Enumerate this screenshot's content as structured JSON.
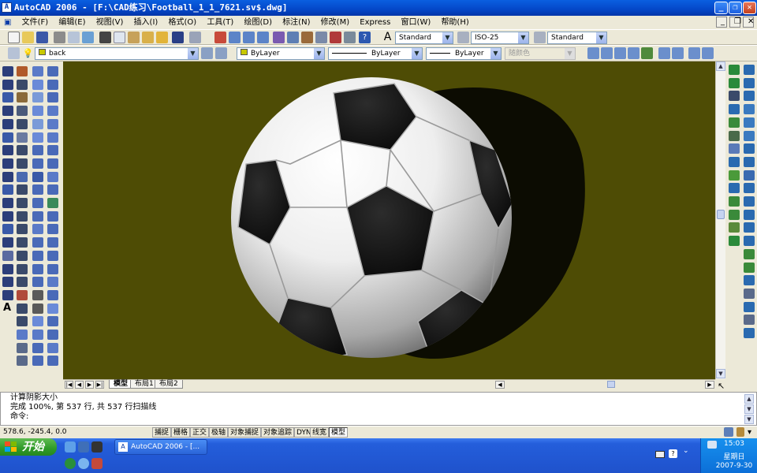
{
  "window": {
    "title": "AutoCAD 2006 - [F:\\CAD练习\\Football_1_1_7621.sv$.dwg]",
    "minimize": "_",
    "restore": "❐",
    "close": "✕"
  },
  "menu": {
    "items": [
      "文件(F)",
      "编辑(E)",
      "视图(V)",
      "插入(I)",
      "格式(O)",
      "工具(T)",
      "绘图(D)",
      "标注(N)",
      "修改(M)",
      "Express",
      "窗口(W)",
      "帮助(H)"
    ]
  },
  "toolbar_styles": {
    "text_style": "Standard",
    "dim_style": "ISO-25",
    "table_style": "Standard"
  },
  "toolbar_layers": {
    "layer": "back",
    "color": "ByLayer",
    "linetype": "ByLayer",
    "lineweight": "ByLayer",
    "plotstyle": "随颜色"
  },
  "layout_tabs": [
    "模型",
    "布局1",
    "布局2"
  ],
  "command": {
    "lines": [
      "计算阴影大小",
      "完成 100%, 第 537 行, 共 537 行扫描线"
    ],
    "prompt": "命令:"
  },
  "status": {
    "coords": "578.6,  -245.4, 0.0",
    "toggles": [
      "捕捉",
      "栅格",
      "正交",
      "极轴",
      "对象捕捉",
      "对象追踪",
      "DYN",
      "线宽",
      "模型"
    ]
  },
  "taskbar": {
    "start": "开始",
    "task": "AutoCAD 2006 - [...",
    "time": "15:03",
    "weekday": "星期日",
    "date": "2007-9-30"
  },
  "colors": {
    "viewport_bg": "#4e4c05",
    "titlebar": "#0447c8",
    "taskbar": "#245edb",
    "start_button": "#2e9a28"
  }
}
